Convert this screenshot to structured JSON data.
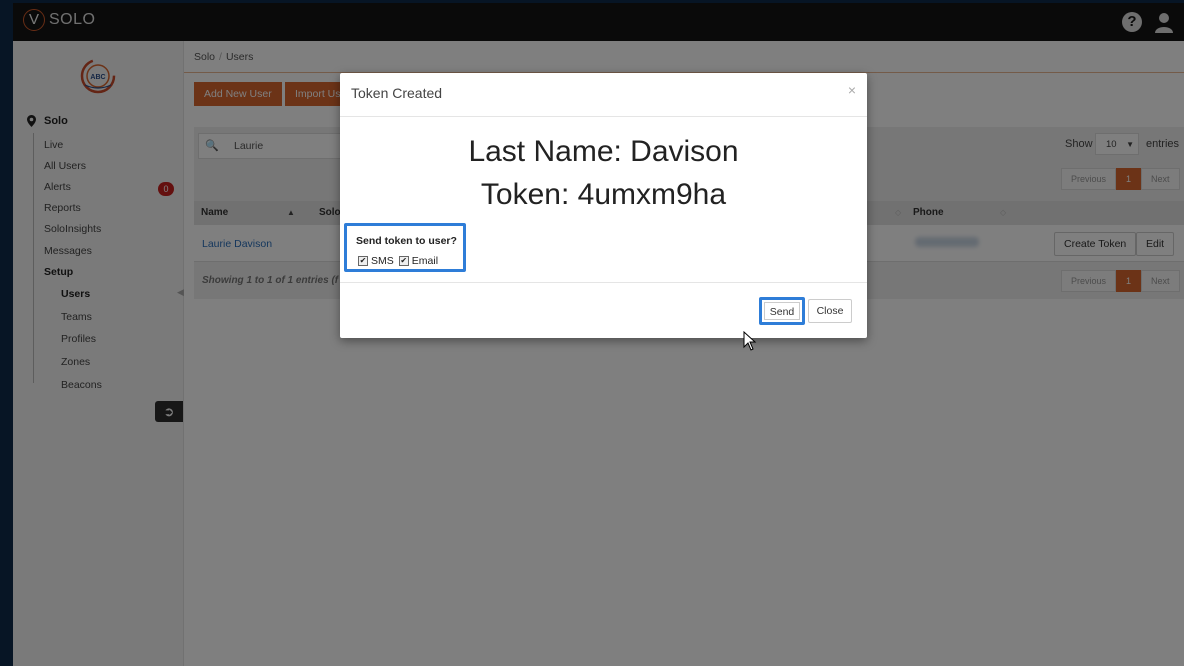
{
  "app": {
    "brand_letter": "V",
    "brand_name": "SOLO"
  },
  "header": {
    "help_icon_glyph": "?"
  },
  "sidebar": {
    "root_label": "Solo",
    "alerts_badge": "0",
    "items": [
      {
        "label": "Live"
      },
      {
        "label": "All Users"
      },
      {
        "label": "Alerts"
      },
      {
        "label": "Reports"
      },
      {
        "label": "SoloInsights"
      },
      {
        "label": "Messages"
      },
      {
        "label": "Setup"
      }
    ],
    "setup_items": [
      {
        "label": "Users"
      },
      {
        "label": "Teams"
      },
      {
        "label": "Profiles"
      },
      {
        "label": "Zones"
      },
      {
        "label": "Beacons"
      }
    ],
    "org_logo_text": "ABC"
  },
  "breadcrumb": {
    "root": "Solo",
    "sep": "/",
    "current": "Users"
  },
  "toolbar": {
    "add_user": "Add New User",
    "import_users": "Import Users"
  },
  "table": {
    "search_value": "Laurie",
    "show_label": "Show",
    "show_value": "10",
    "entries_label": "entries",
    "pager": {
      "previous": "Previous",
      "page": "1",
      "next": "Next"
    },
    "columns": {
      "name": "Name",
      "solo": "Solo",
      "phone": "Phone"
    },
    "rows": [
      {
        "name": "Laurie Davison"
      }
    ],
    "row_actions": {
      "create_token": "Create Token",
      "edit": "Edit"
    },
    "showing": "Showing 1 to 1 of 1 entries (f"
  },
  "modal": {
    "title": "Token Created",
    "close_glyph": "×",
    "last_name_line": "Last Name: Davison",
    "token_line": "Token: 4umxm9ha",
    "send_question": "Send token to user?",
    "sms_label": "SMS",
    "email_label": "Email",
    "sms_checked": true,
    "email_checked": true,
    "send_button": "Send",
    "close_button": "Close"
  },
  "colors": {
    "accent": "#d9662f",
    "highlight": "#2e7dd8",
    "badge": "#c9211e",
    "link": "#2a6ebb"
  }
}
